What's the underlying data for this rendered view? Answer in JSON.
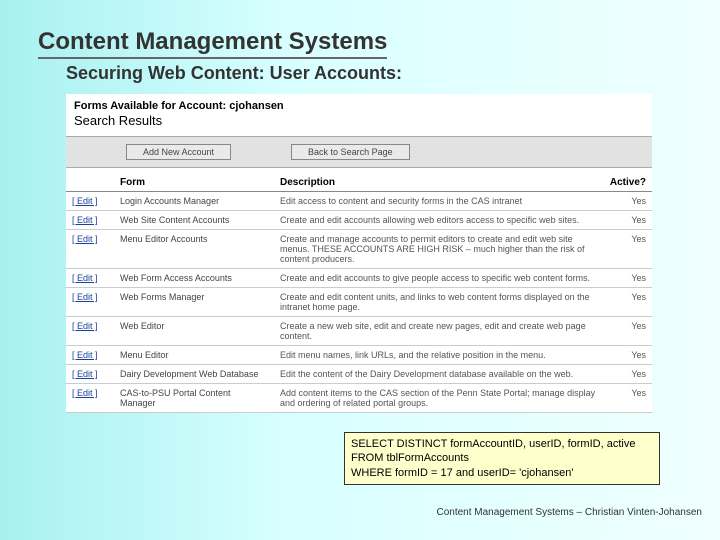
{
  "title": "Content Management Systems",
  "subtitle": "Securing Web Content: User Accounts:",
  "panel": {
    "heading": "Forms Available for Account: cjohansen",
    "subheading": "Search Results",
    "buttons": {
      "add": "Add New Account",
      "back": "Back to Search Page"
    }
  },
  "columns": {
    "edit": "",
    "form": "Form",
    "desc": "Description",
    "active": "Active?"
  },
  "rows": [
    {
      "edit": "[ Edit ]",
      "form": "Login Accounts Manager",
      "desc": "Edit access to content and security forms in the CAS intranet",
      "active": "Yes"
    },
    {
      "edit": "[ Edit ]",
      "form": "Web Site Content Accounts",
      "desc": "Create and edit accounts allowing web editors access to specific web sites.",
      "active": "Yes"
    },
    {
      "edit": "[ Edit ]",
      "form": "Menu Editor Accounts",
      "desc": "Create and manage accounts to permit editors to create and edit web site menus. THESE ACCOUNTS ARE HIGH RISK – much higher than the risk of content producers.",
      "active": "Yes"
    },
    {
      "edit": "[ Edit ]",
      "form": "Web Form Access Accounts",
      "desc": "Create and edit accounts to give people access to specific web content forms.",
      "active": "Yes"
    },
    {
      "edit": "[ Edit ]",
      "form": "Web Forms Manager",
      "desc": "Create and edit content units, and links to web content forms displayed on the intranet home page.",
      "active": "Yes"
    },
    {
      "edit": "[ Edit ]",
      "form": "Web Editor",
      "desc": "Create a new web site, edit and create new pages, edit and create web page content.",
      "active": "Yes"
    },
    {
      "edit": "[ Edit ]",
      "form": "Menu Editor",
      "desc": "Edit menu names, link URLs, and the relative position in the menu.",
      "active": "Yes"
    },
    {
      "edit": "[ Edit ]",
      "form": "Dairy Development Web Database",
      "desc": "Edit the content of the Dairy Development database available on the web.",
      "active": "Yes"
    },
    {
      "edit": "[ Edit ]",
      "form": "CAS-to-PSU Portal Content Manager",
      "desc": "Add content items to the CAS section of the Penn State Portal; manage display and ordering of related portal groups.",
      "active": "Yes"
    }
  ],
  "sql": {
    "l1": "SELECT DISTINCT formAccountID, userID, formID, active",
    "l2": "FROM tblFormAccounts",
    "l3": "WHERE formID = 17 and userID= 'cjohansen'"
  },
  "footer": "Content Management Systems – Christian Vinten-Johansen"
}
